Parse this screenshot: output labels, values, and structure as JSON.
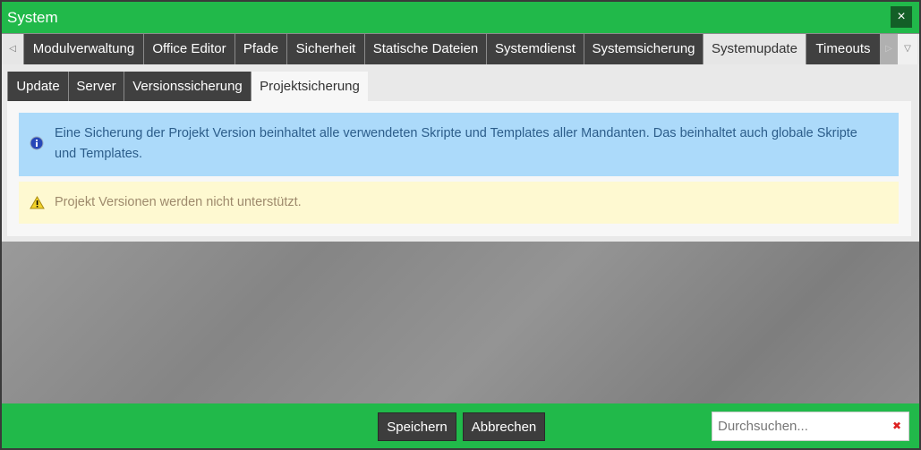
{
  "window": {
    "title": "System",
    "close_icon": "×"
  },
  "tabs": {
    "items": [
      "Modulverwaltung",
      "Office Editor",
      "Pfade",
      "Sicherheit",
      "Statische Dateien",
      "Systemdienst",
      "Systemsicherung",
      "Systemupdate",
      "Timeouts"
    ],
    "active": "Systemupdate",
    "left_arrow": "◁",
    "right_arrow": "▷",
    "dropdown": "▽"
  },
  "subtabs": {
    "items": [
      "Update",
      "Server",
      "Versionssicherung",
      "Projektsicherung"
    ],
    "active": "Projektsicherung"
  },
  "info": {
    "text": "Eine Sicherung der Projekt Version beinhaltet alle verwendeten Skripte und Templates aller Mandanten. Das beinhaltet auch globale Skripte und Templates.",
    "icon": "info-icon"
  },
  "warning": {
    "text": "Projekt Versionen werden nicht unterstützt.",
    "icon": "warning-icon"
  },
  "footer": {
    "save": "Speichern",
    "cancel": "Abbrechen",
    "search_placeholder": "Durchsuchen...",
    "clear_icon": "✖"
  },
  "colors": {
    "accent": "#21b94a",
    "tab_dark": "#404040",
    "info_bg": "#acdafa",
    "warning_bg": "#fef9d1"
  }
}
